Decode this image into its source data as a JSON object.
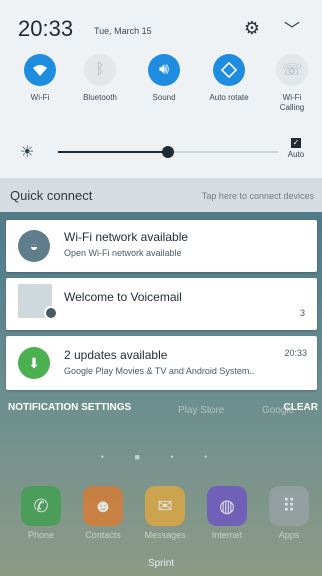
{
  "status": {
    "time": "20:33",
    "date": "Tue, March 15",
    "settings_icon": "gear-icon",
    "expand_icon": "chevron-down-icon"
  },
  "quick_settings": [
    {
      "label": "Wi-Fi",
      "icon": "wifi-icon",
      "on": true
    },
    {
      "label": "Bluetooth",
      "icon": "bluetooth-icon",
      "on": false
    },
    {
      "label": "Sound",
      "icon": "speaker-icon",
      "on": true
    },
    {
      "label": "Auto rotate",
      "icon": "rotate-icon",
      "on": true
    },
    {
      "label": "Wi-Fi Calling",
      "icon": "wifi-calling-icon",
      "on": false
    }
  ],
  "brightness": {
    "level": 0.5,
    "auto_label": "Auto",
    "auto_checked": true
  },
  "quick_connect": {
    "label": "Quick connect",
    "hint": "Tap here to connect devices"
  },
  "notifications": [
    {
      "title": "Wi-Fi network available",
      "subtitle": "Open Wi-Fi network available",
      "time": "",
      "count": "",
      "icon": "wifi-network-icon"
    },
    {
      "title": "Welcome to Voicemail",
      "subtitle": "",
      "time": "",
      "count": "3",
      "icon": "voicemail-icon"
    },
    {
      "title": "2 updates available",
      "subtitle": "Google Play Movies & TV and Android System..",
      "time": "20:33",
      "count": "",
      "icon": "update-icon"
    }
  ],
  "footer": {
    "notification_settings": "NOTIFICATION SETTINGS",
    "clear": "CLEAR"
  },
  "home": {
    "top_apps": [
      "Play Store",
      "Google"
    ],
    "dock_apps": [
      {
        "label": "Phone",
        "icon": "phone-icon",
        "color": "#3aa04a"
      },
      {
        "label": "Contacts",
        "icon": "contacts-icon",
        "color": "#e07a2c"
      },
      {
        "label": "Messages",
        "icon": "messages-icon",
        "color": "#e6a83a"
      },
      {
        "label": "Internet",
        "icon": "globe-icon",
        "color": "#6b4fc8"
      },
      {
        "label": "Apps",
        "icon": "apps-grid-icon",
        "color": "#9aa3a8"
      }
    ],
    "carrier": "Sprint"
  },
  "colors": {
    "accent": "#1e8de0",
    "panel": "#eef2f5"
  }
}
